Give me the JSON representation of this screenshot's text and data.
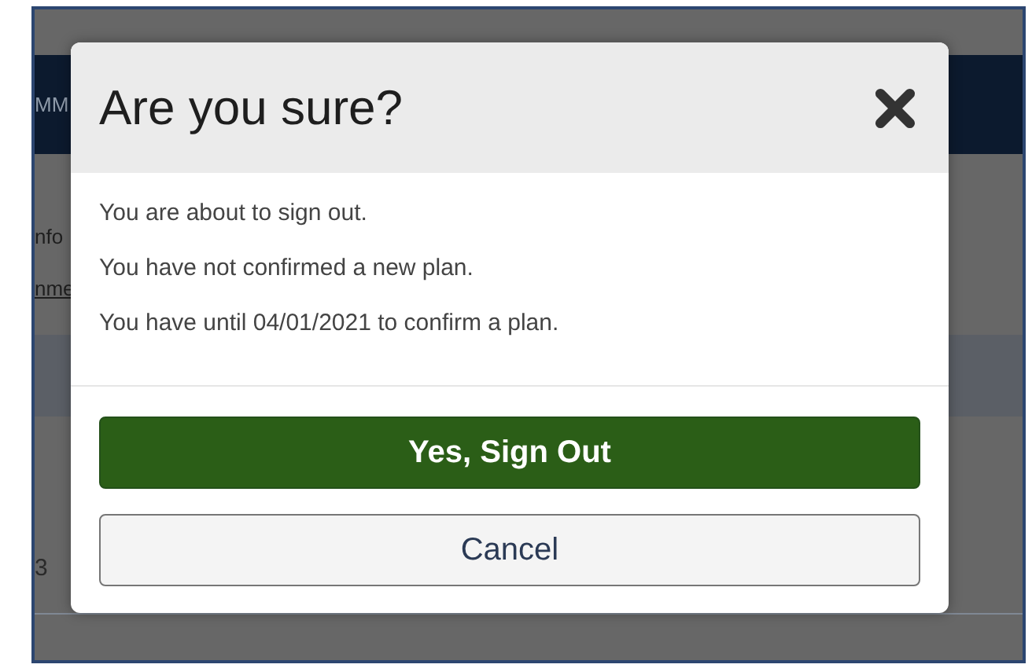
{
  "background": {
    "header_text": "MM",
    "texts": [
      {
        "text": "nfo",
        "kind": "plain"
      },
      {
        "text": "nme",
        "kind": "link"
      }
    ],
    "row_text": "3"
  },
  "dialog": {
    "title": "Are you sure?",
    "messages": [
      "You are about to sign out.",
      "You have not confirmed a new plan.",
      "You have until 04/01/2021 to confirm a plan."
    ],
    "buttons": [
      {
        "label": "Yes, Sign Out",
        "kind": "primary"
      },
      {
        "label": "Cancel",
        "kind": "secondary"
      }
    ]
  }
}
